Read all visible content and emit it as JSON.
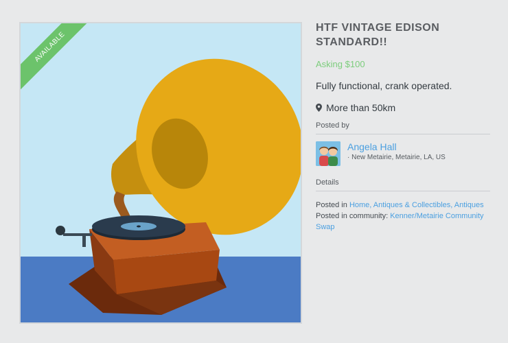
{
  "listing": {
    "status_badge": "AVAILABLE",
    "title": "HTF VINTAGE EDISON STANDARD!!",
    "price": "Asking $100",
    "description": "Fully functional, crank operated.",
    "distance": "More than 50km",
    "image_icon": "gramophone-illustration"
  },
  "seller": {
    "section_label": "Posted by",
    "name": "Angela Hall",
    "location": "· New Metairie, Metairie, LA, US"
  },
  "details": {
    "section_label": "Details",
    "posted_in_prefix": "Posted in",
    "categories": "Home, Antiques & Collectibles, Antiques",
    "community_prefix": "Posted in community:",
    "community": "Kenner/Metairie Community Swap"
  },
  "colors": {
    "available": "#6cc36b",
    "price": "#7ccd7c",
    "link": "#4a9fe0",
    "sky": "#c5e7f5",
    "floor": "#4b7bc4",
    "horn": "#e6a916"
  }
}
